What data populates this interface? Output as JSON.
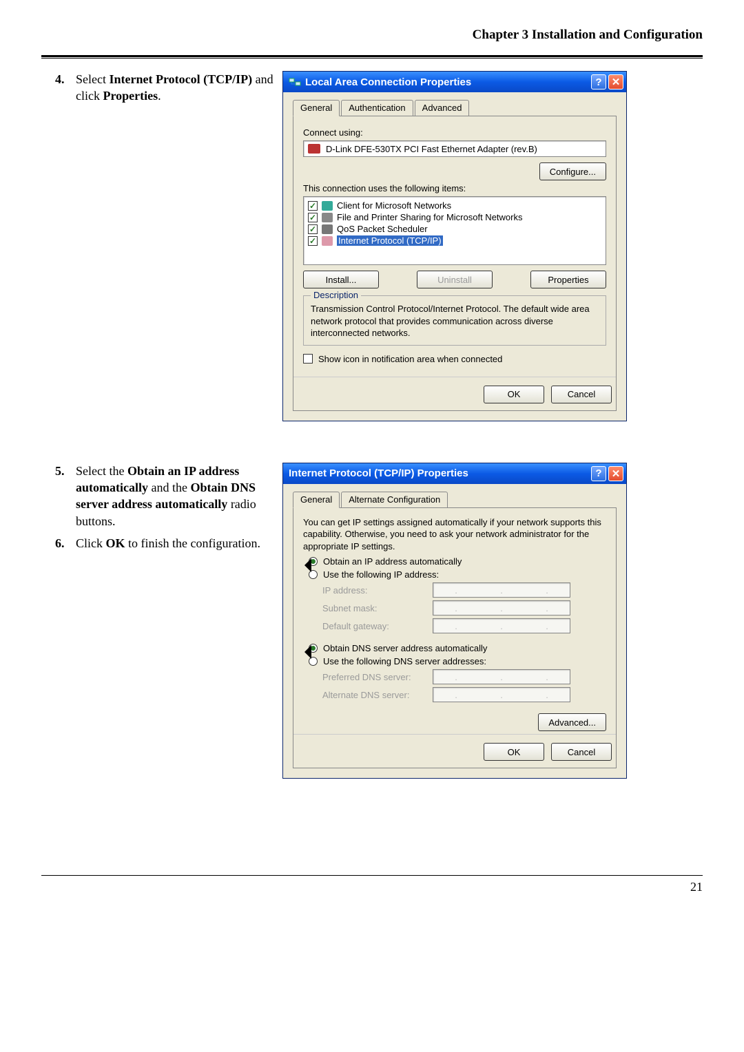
{
  "header": "Chapter 3 Installation and Configuration",
  "page_number": "21",
  "step4": {
    "num": "4.",
    "prefix": "Select ",
    "bold1": "Internet Protocol (TCP/IP)",
    "mid": " and click ",
    "bold2": "Properties",
    "suffix": "."
  },
  "steps56": [
    {
      "num": "5.",
      "parts": [
        "Select the ",
        "Obtain an IP address automatically",
        " and the ",
        "Obtain DNS server address automatically",
        " radio buttons."
      ]
    },
    {
      "num": "6.",
      "parts": [
        "Click ",
        "OK",
        " to finish the configuration."
      ]
    }
  ],
  "win1": {
    "title": "Local Area Connection Properties",
    "tabs": [
      "General",
      "Authentication",
      "Advanced"
    ],
    "connect_using_label": "Connect using:",
    "adapter": "D-Link DFE-530TX PCI Fast Ethernet Adapter (rev.B)",
    "configure_btn": "Configure...",
    "items_label": "This connection uses the following items:",
    "items": [
      {
        "label": "Client for Microsoft Networks",
        "checked": true,
        "selected": false,
        "icon": "net"
      },
      {
        "label": "File and Printer Sharing for Microsoft Networks",
        "checked": true,
        "selected": false,
        "icon": "prn"
      },
      {
        "label": "QoS Packet Scheduler",
        "checked": true,
        "selected": false,
        "icon": "qos"
      },
      {
        "label": "Internet Protocol (TCP/IP)",
        "checked": true,
        "selected": true,
        "icon": "tcp"
      }
    ],
    "install_btn": "Install...",
    "uninstall_btn": "Uninstall",
    "properties_btn": "Properties",
    "desc_legend": "Description",
    "description": "Transmission Control Protocol/Internet Protocol. The default wide area network protocol that provides communication across diverse interconnected networks.",
    "show_icon_label": "Show icon in notification area when connected",
    "ok": "OK",
    "cancel": "Cancel"
  },
  "win2": {
    "title": "Internet Protocol (TCP/IP) Properties",
    "tabs": [
      "General",
      "Alternate Configuration"
    ],
    "intro": "You can get IP settings assigned automatically if your network supports this capability. Otherwise, you need to ask your network administrator for the appropriate IP settings.",
    "obtain_ip": "Obtain an IP address automatically",
    "use_ip": "Use the following IP address:",
    "ip_label": "IP address:",
    "subnet_label": "Subnet mask:",
    "gateway_label": "Default gateway:",
    "obtain_dns": "Obtain DNS server address automatically",
    "use_dns": "Use the following DNS server addresses:",
    "pref_dns": "Preferred DNS server:",
    "alt_dns": "Alternate DNS server:",
    "advanced_btn": "Advanced...",
    "ok": "OK",
    "cancel": "Cancel"
  }
}
